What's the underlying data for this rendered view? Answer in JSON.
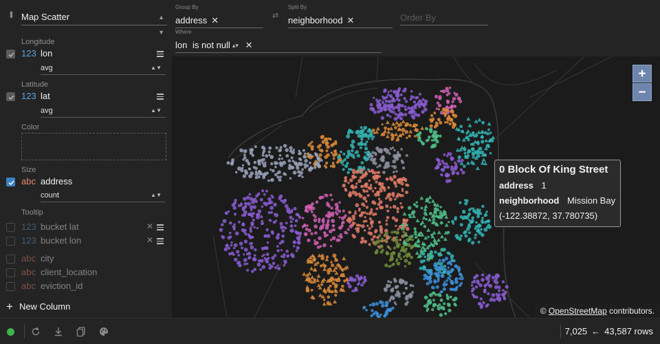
{
  "plugin": {
    "name": "Map Scatter"
  },
  "columns": {
    "longitude": {
      "label": "Longitude",
      "type": "123",
      "name": "lon",
      "agg": "avg"
    },
    "latitude": {
      "label": "Latitude",
      "type": "123",
      "name": "lat",
      "agg": "avg"
    },
    "color": {
      "label": "Color"
    },
    "size": {
      "label": "Size",
      "type": "abc",
      "name": "address",
      "agg": "count"
    },
    "tooltip": {
      "label": "Tooltip"
    },
    "inactive": [
      {
        "type": "123",
        "name": "bucket lat"
      },
      {
        "type": "123",
        "name": "bucket lon"
      },
      {
        "type": "abc",
        "name": "city"
      },
      {
        "type": "abc",
        "name": "client_location"
      },
      {
        "type": "abc",
        "name": "eviction_id"
      }
    ],
    "new_column": "New Column"
  },
  "pivot": {
    "group_by": {
      "label": "Group By",
      "value": "address"
    },
    "split_by": {
      "label": "Split By",
      "value": "neighborhood"
    },
    "order_by": {
      "label": "Order By",
      "placeholder": "Order By"
    },
    "where": {
      "label": "Where",
      "column": "lon",
      "operator": "is not null"
    }
  },
  "map": {
    "tooltip": {
      "title": "0 Block Of King Street",
      "rows": [
        {
          "key": "address",
          "value": "1"
        },
        {
          "key": "neighborhood",
          "value": "Mission Bay"
        }
      ],
      "coords": "(-122.38872, 37.780735)"
    },
    "attribution_symbol": "©",
    "attribution_link": "OpenStreetMap",
    "attribution_suffix": "contributors.",
    "zoom_in": "+",
    "zoom_out": "−",
    "palette": [
      "#8a5cd1",
      "#e07a66",
      "#d98a3a",
      "#34b3b3",
      "#9aa2bb",
      "#3b8fd9",
      "#6f8a3a",
      "#cc5fb3",
      "#4fbf8a",
      "#8c8fa0"
    ]
  },
  "status": {
    "connected_color": "#3cb44b",
    "rows_shown": "7,025",
    "arrow": "←",
    "rows_total": "43,587 rows"
  }
}
